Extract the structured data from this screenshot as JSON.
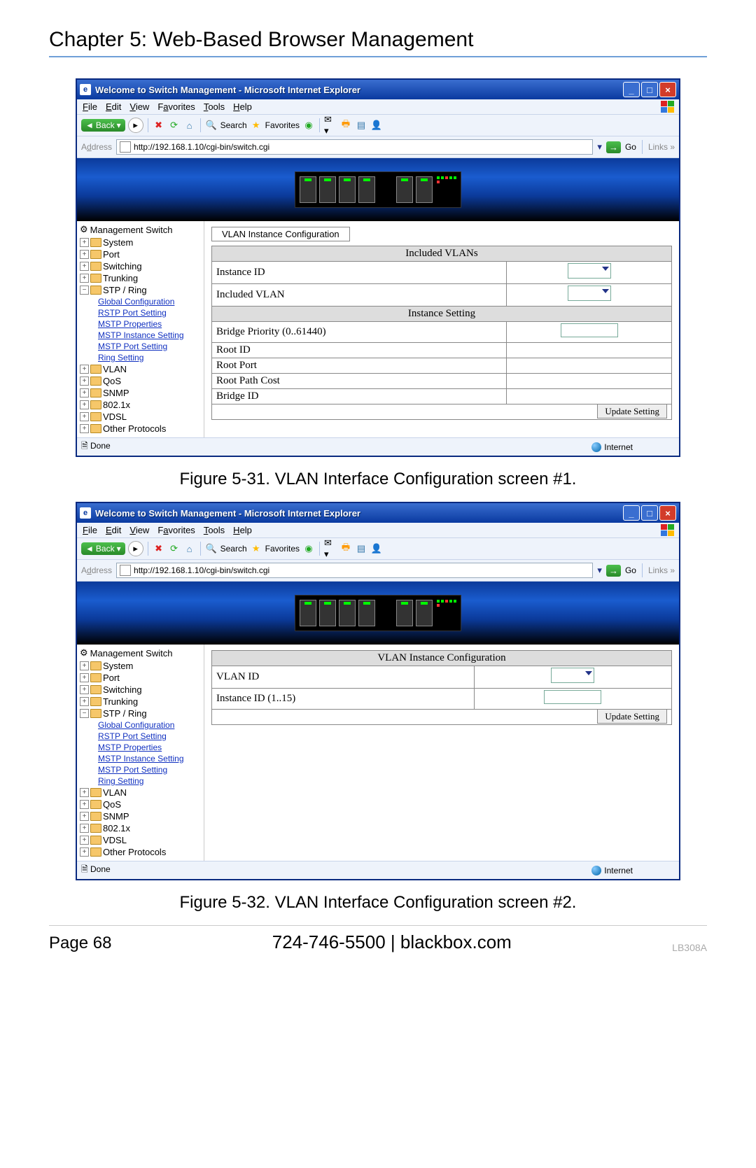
{
  "chapter_title": "Chapter 5: Web-Based Browser Management",
  "caption1": "Figure 5-31. VLAN Interface Configuration screen #1.",
  "caption2": "Figure 5-32. VLAN Interface Configuration screen #2.",
  "footer": {
    "page": "Page 68",
    "center": "724-746-5500   |   blackbox.com",
    "model": "LB308A"
  },
  "ie": {
    "title": "Welcome to Switch Management - Microsoft Internet Explorer",
    "menus": {
      "file": "File",
      "edit": "Edit",
      "view": "View",
      "fav": "Favorites",
      "tools": "Tools",
      "help": "Help"
    },
    "toolbar": {
      "back": "Back",
      "search": "Search",
      "favorites": "Favorites"
    },
    "address_label": "Address",
    "url": "http://192.168.1.10/cgi-bin/switch.cgi",
    "go": "Go",
    "links": "Links",
    "status_done": "Done",
    "status_zone": "Internet"
  },
  "tree": {
    "root": "Management Switch",
    "items": [
      "System",
      "Port",
      "Switching",
      "Trunking",
      "STP / Ring",
      "VLAN",
      "QoS",
      "SNMP",
      "802.1x",
      "VDSL",
      "Other Protocols"
    ],
    "stp_children": [
      "Global Configuration",
      "RSTP Port Setting",
      "MSTP Properties",
      "MSTP Instance Setting",
      "MSTP Port Setting",
      "Ring Setting"
    ]
  },
  "screen1": {
    "tab": "VLAN Instance Configuration",
    "section1": "Included VLANs",
    "rows1": [
      {
        "label": "Instance ID",
        "ctrl": "select"
      },
      {
        "label": "Included VLAN",
        "ctrl": "select"
      }
    ],
    "section2": "Instance Setting",
    "rows2": [
      {
        "label": "Bridge Priority (0..61440)",
        "ctrl": "text"
      },
      {
        "label": "Root ID",
        "ctrl": ""
      },
      {
        "label": "Root Port",
        "ctrl": ""
      },
      {
        "label": "Root Path Cost",
        "ctrl": ""
      },
      {
        "label": "Bridge ID",
        "ctrl": ""
      }
    ],
    "update": "Update Setting"
  },
  "screen2": {
    "section": "VLAN Instance Configuration",
    "rows": [
      {
        "label": "VLAN ID",
        "ctrl": "select"
      },
      {
        "label": "Instance ID (1..15)",
        "ctrl": "text"
      }
    ],
    "update": "Update Setting"
  }
}
